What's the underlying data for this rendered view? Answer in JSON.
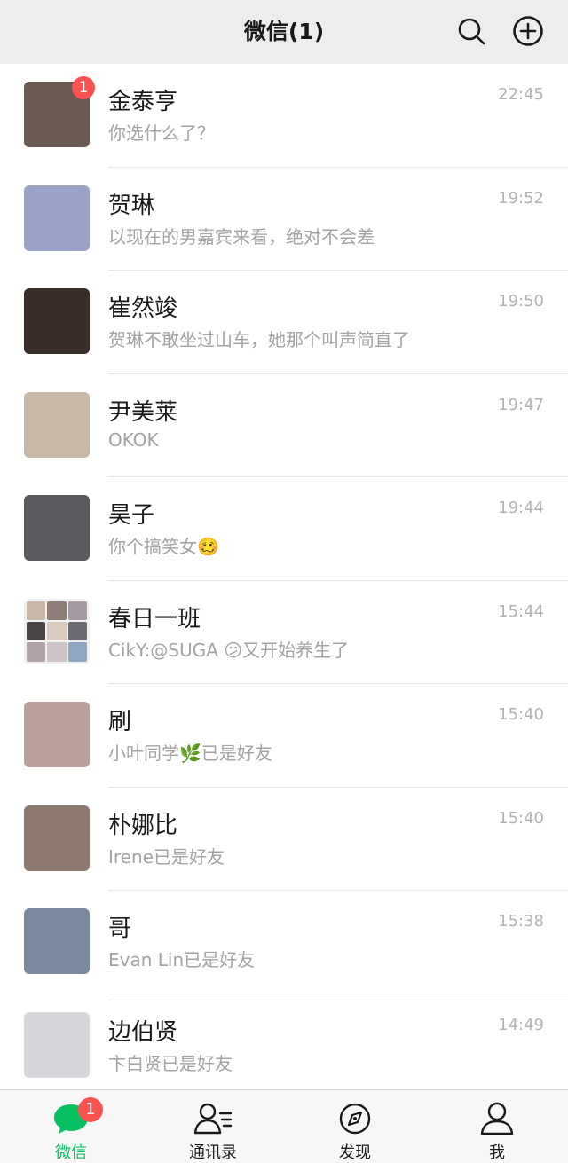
{
  "header": {
    "title": "微信(1)"
  },
  "chats": [
    {
      "name": "金泰亨",
      "preview": "你选什么了？",
      "time": "22:45",
      "badge": "1",
      "avatar_color": "#6b5b52"
    },
    {
      "name": "贺琳",
      "preview": "以现在的男嘉宾来看，绝对不会差",
      "time": "19:52",
      "badge": "",
      "avatar_color": "#9aa3c7"
    },
    {
      "name": "崔然竣",
      "preview": "贺琳不敢坐过山车，她那个叫声简直了",
      "time": "19:50",
      "badge": "",
      "avatar_color": "#3a2e2a"
    },
    {
      "name": "尹美莱",
      "preview": "OKOK",
      "time": "19:47",
      "badge": "",
      "avatar_color": "#c8b8a8"
    },
    {
      "name": "昊子",
      "preview": "你个搞笑女🥴",
      "time": "19:44",
      "badge": "",
      "avatar_color": "#5a5a5e"
    },
    {
      "name": "春日一班",
      "preview": "CikY:@SUGA 😕又开始养生了",
      "time": "15:44",
      "badge": "",
      "avatar_color": "#d9cfc8"
    },
    {
      "name": "刷",
      "preview": "小叶同学🌿已是好友",
      "time": "15:40",
      "badge": "",
      "avatar_color": "#b9a09a"
    },
    {
      "name": "朴娜比",
      "preview": "Irene已是好友",
      "time": "15:40",
      "badge": "",
      "avatar_color": "#8c7a70"
    },
    {
      "name": "哥",
      "preview": "Evan Lin已是好友",
      "time": "15:38",
      "badge": "",
      "avatar_color": "#7b8a9c"
    },
    {
      "name": "边伯贤",
      "preview": "卞白贤已是好友",
      "time": "14:49",
      "badge": "",
      "avatar_color": "#d6d6da"
    }
  ],
  "tabs": [
    {
      "label": "微信",
      "badge": "1",
      "icon": "chat-bubble-icon"
    },
    {
      "label": "通讯录",
      "badge": "",
      "icon": "contacts-icon"
    },
    {
      "label": "发现",
      "badge": "",
      "icon": "compass-icon"
    },
    {
      "label": "我",
      "badge": "",
      "icon": "person-icon"
    }
  ],
  "colors": {
    "accent": "#07c160",
    "badge": "#fa5151",
    "topbar": "#ededed"
  }
}
